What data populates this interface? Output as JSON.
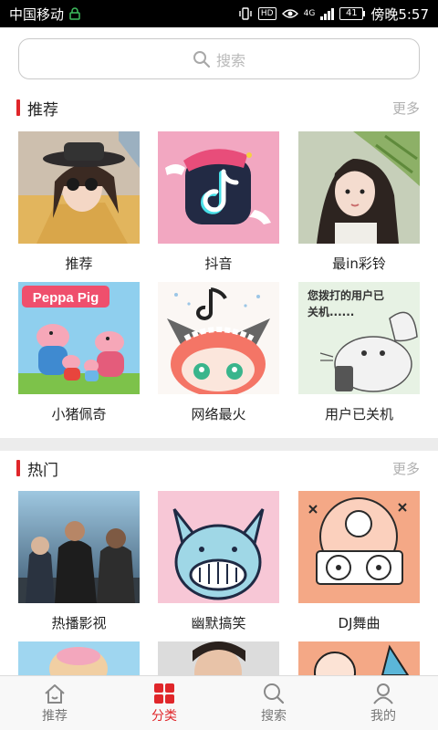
{
  "status_bar": {
    "carrier": "中国移动",
    "network": "4G",
    "battery": "41",
    "time": "傍晚5:57",
    "icons": [
      "lock-icon",
      "vibrate-icon",
      "hd-icon",
      "eye-icon",
      "signal-icon",
      "battery-icon"
    ]
  },
  "search": {
    "placeholder": "搜索"
  },
  "sections": {
    "recommend": {
      "title": "推荐",
      "more": "更多",
      "items": [
        {
          "label": "推荐"
        },
        {
          "label": "抖音"
        },
        {
          "label": "最in彩铃"
        },
        {
          "label": "小猪佩奇"
        },
        {
          "label": "网络最火"
        },
        {
          "label": "用户已关机"
        }
      ]
    },
    "hot": {
      "title": "热门",
      "more": "更多",
      "items": [
        {
          "label": "热播影视"
        },
        {
          "label": "幽默搞笑"
        },
        {
          "label": "DJ舞曲"
        }
      ]
    }
  },
  "thumb_text": {
    "peppa": "Peppa Pig",
    "user_off": "您拨打的用户已关机......"
  },
  "tabs": [
    {
      "label": "推荐",
      "icon": "home-icon",
      "active": false
    },
    {
      "label": "分类",
      "icon": "grid-icon",
      "active": true
    },
    {
      "label": "搜索",
      "icon": "search-icon",
      "active": false
    },
    {
      "label": "我的",
      "icon": "person-icon",
      "active": false
    }
  ],
  "colors": {
    "accent": "#e0262a",
    "muted": "#b0b0b0"
  }
}
